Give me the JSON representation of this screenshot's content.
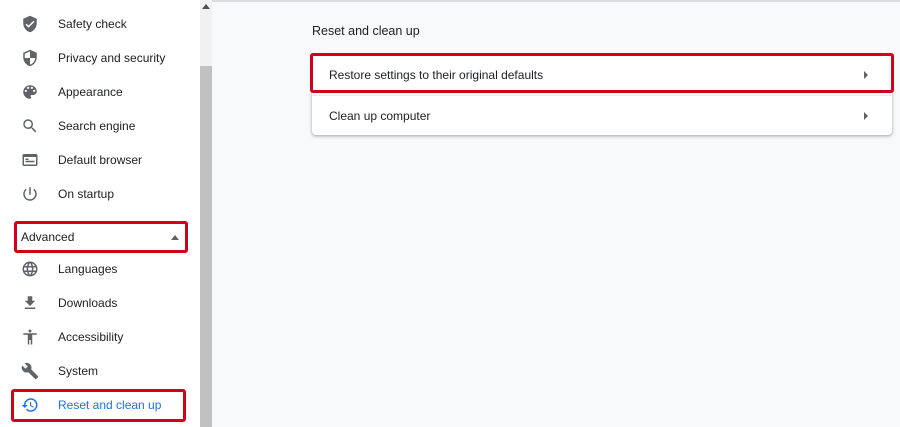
{
  "sidebar": {
    "items": [
      {
        "label": "Safety check",
        "icon": "shield-check-icon"
      },
      {
        "label": "Privacy and security",
        "icon": "shield-icon"
      },
      {
        "label": "Appearance",
        "icon": "palette-icon"
      },
      {
        "label": "Search engine",
        "icon": "search-icon"
      },
      {
        "label": "Default browser",
        "icon": "browser-icon"
      },
      {
        "label": "On startup",
        "icon": "power-icon"
      }
    ],
    "advanced_label": "Advanced",
    "advanced_items": [
      {
        "label": "Languages",
        "icon": "globe-icon"
      },
      {
        "label": "Downloads",
        "icon": "download-icon"
      },
      {
        "label": "Accessibility",
        "icon": "accessibility-icon"
      },
      {
        "label": "System",
        "icon": "wrench-icon"
      },
      {
        "label": "Reset and clean up",
        "icon": "restore-icon"
      }
    ],
    "active_item": "Reset and clean up"
  },
  "main": {
    "section_title": "Reset and clean up",
    "rows": [
      {
        "label": "Restore settings to their original defaults"
      },
      {
        "label": "Clean up computer"
      }
    ]
  },
  "colors": {
    "accent": "#1a73e8",
    "highlight": "#d0021b",
    "icon": "#5f6368"
  }
}
